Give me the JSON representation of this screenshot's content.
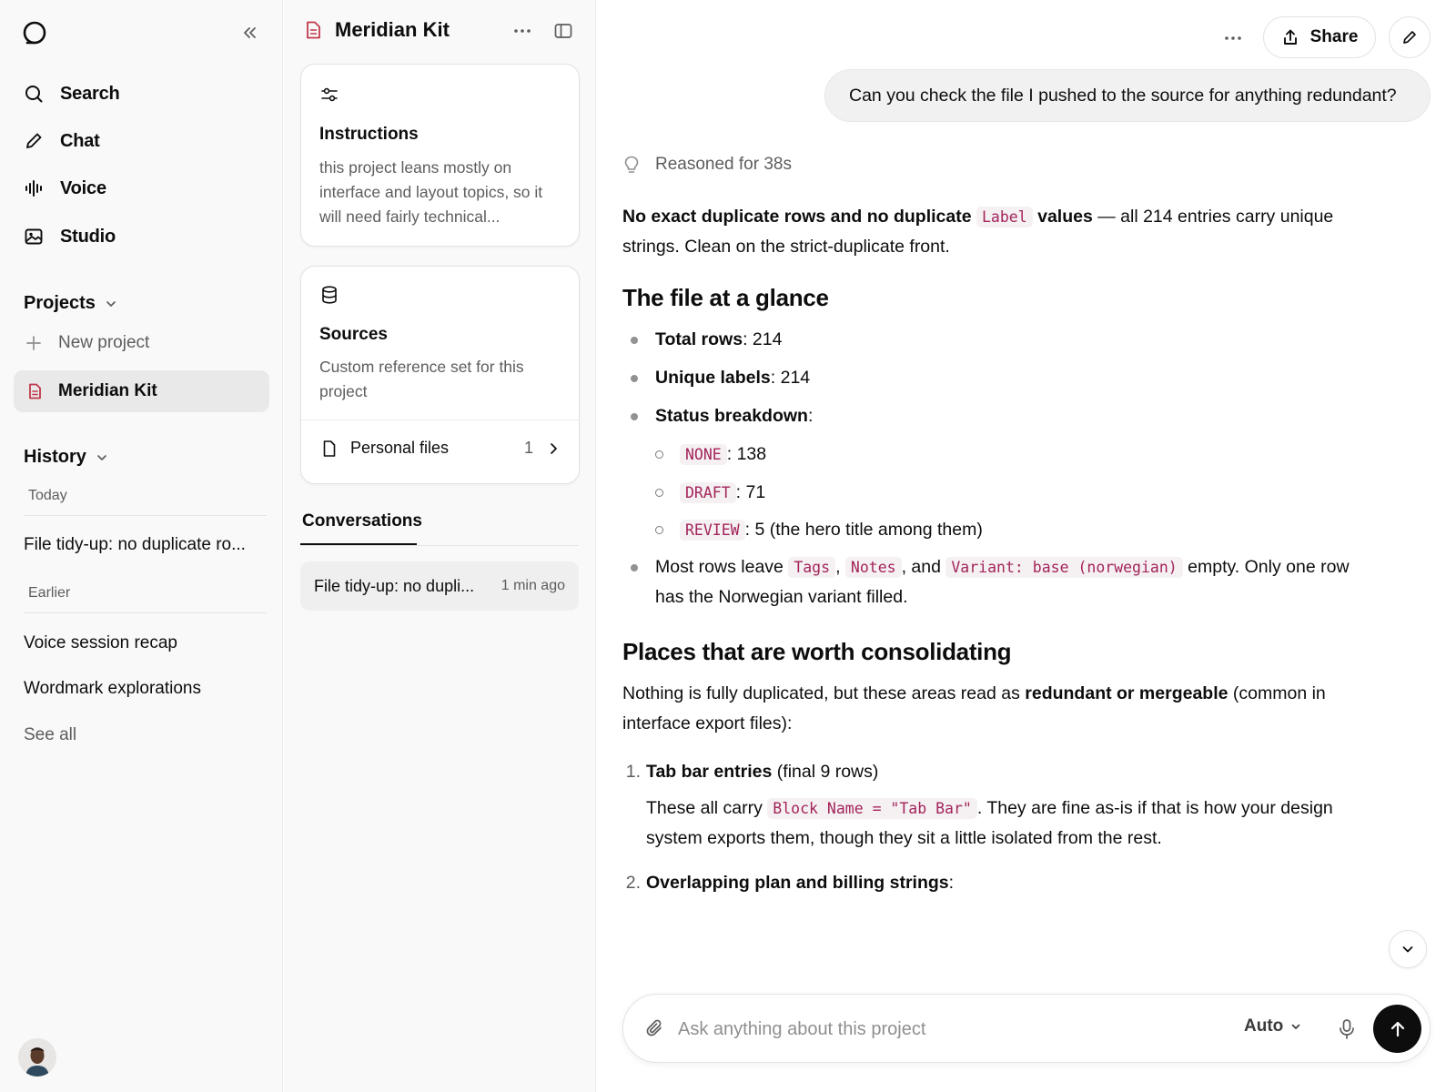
{
  "nav": {
    "search": "Search",
    "chat": "Chat",
    "voice": "Voice",
    "studio": "Studio"
  },
  "projects": {
    "heading": "Projects",
    "new_project": "New project",
    "active": "Meridian Kit"
  },
  "history": {
    "heading": "History",
    "today_label": "Today",
    "today_items": [
      "File tidy-up: no duplicate ro..."
    ],
    "earlier_label": "Earlier",
    "earlier_items": [
      "Voice session recap",
      "Wordmark explorations"
    ],
    "see_all": "See all"
  },
  "project_panel": {
    "title": "Meridian Kit",
    "instructions": {
      "title": "Instructions",
      "body": "this project leans mostly on interface and layout topics, so it will need fairly technical..."
    },
    "sources": {
      "title": "Sources",
      "body": "Custom reference set for this project",
      "files_label": "Personal files",
      "files_count": "1"
    },
    "conversations_tab": "Conversations",
    "conversations": [
      {
        "title": "File tidy-up: no dupli...",
        "time": "1 min ago"
      }
    ]
  },
  "header": {
    "share_label": "Share"
  },
  "chat": {
    "user_message": "Can you check the file I pushed to the source for anything redundant?",
    "reasoned": "Reasoned for 38s",
    "intro": {
      "bold_a": "No exact duplicate rows and no duplicate",
      "code_label": "Label",
      "bold_b": "values",
      "rest": " — all 214 entries carry unique strings. Clean on the strict-duplicate front."
    },
    "h_glance": "The file at a glance",
    "glance": {
      "total_label": "Total rows",
      "total_value": ": 214",
      "unique_label": "Unique labels",
      "unique_value": ": 214",
      "status_label": "Status breakdown",
      "status_colon": ":",
      "statuses": [
        {
          "code": "NONE",
          "text": ": 138"
        },
        {
          "code": "DRAFT",
          "text": ": 71"
        },
        {
          "code": "REVIEW",
          "text": ": 5 (the hero title among them)"
        }
      ],
      "most_a": "Most rows leave ",
      "code_tags": "Tags",
      "comma": ", ",
      "code_notes": "Notes",
      "and": ", and ",
      "code_variant": "Variant: base (norwegian)",
      "most_b": " empty. Only one row has the Norwegian variant filled."
    },
    "h_places": "Places that are worth consolidating",
    "places_intro": {
      "a": "Nothing is fully duplicated, but these areas read as ",
      "bold": "redundant or mergeable",
      "b": " (common in interface export files):"
    },
    "items": [
      {
        "n": "1.",
        "bold": "Tab bar entries",
        "rest": " (final 9 rows)",
        "detail_a": "These all carry ",
        "code": "Block Name = \"Tab Bar\"",
        "detail_b": ". They are fine as-is if that is how your design system exports them, though they sit a little isolated from the rest."
      },
      {
        "n": "2.",
        "bold": "Overlapping plan and billing strings",
        "rest": ":"
      }
    ]
  },
  "composer": {
    "placeholder": "Ask anything about this project",
    "model": "Auto"
  }
}
